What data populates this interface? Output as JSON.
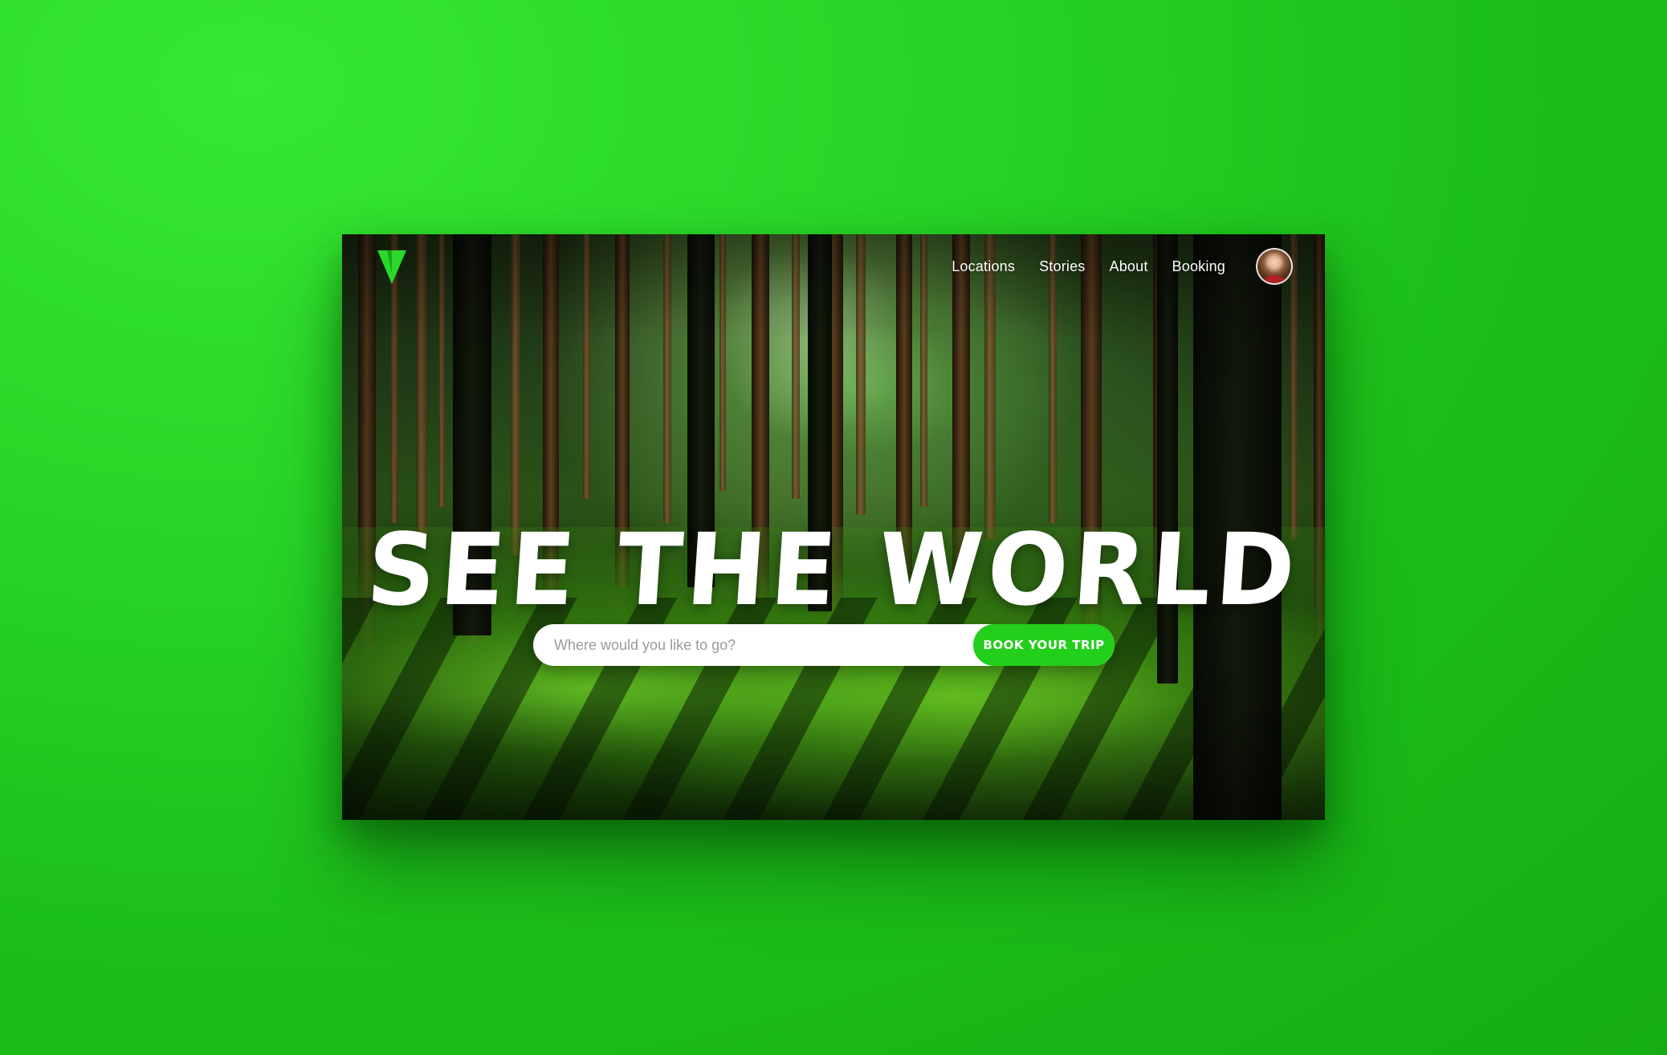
{
  "nav": {
    "links": [
      "Locations",
      "Stories",
      "About",
      "Booking"
    ]
  },
  "logo": {
    "icon": "leaf-triangle-logo-icon",
    "color": "#2bd82a"
  },
  "avatar": {
    "icon": "user-avatar"
  },
  "hero": {
    "title": "SEE THE WORLD"
  },
  "search": {
    "placeholder": "Where would you like to go?",
    "value": "",
    "button_label": "BOOK YOUR TRIP"
  },
  "colors": {
    "accent": "#22cf1a",
    "background": "#1fc41c",
    "text": "#ffffff"
  }
}
